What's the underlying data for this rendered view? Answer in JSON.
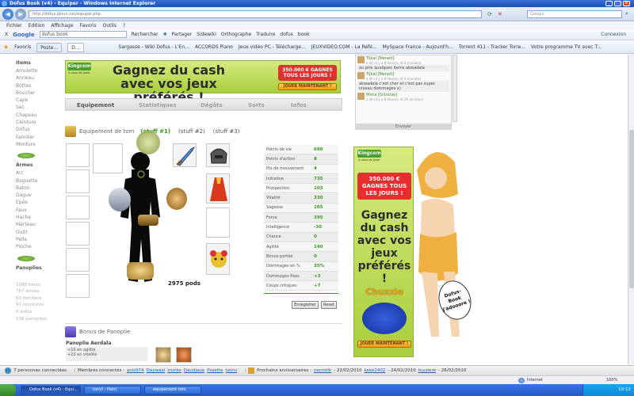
{
  "window": {
    "title": "Dofus Book (v4) - Equiper - Windows Internet Explorer"
  },
  "address": {
    "url": "http://dofus.jdoun.net/equiper.php",
    "search_placeholder": "Google"
  },
  "menu": [
    "Fichier",
    "Edition",
    "Affichage",
    "Favoris",
    "Outils",
    "?"
  ],
  "google_toolbar": {
    "close": "X",
    "brand": "Google",
    "query": "dofus book",
    "items": [
      "Rechercher",
      "Partager",
      "Sidewiki",
      "Orthographe",
      "Traduire",
      "dofus",
      "book"
    ],
    "right": "Connexion"
  },
  "favorites": {
    "label": "Favoris",
    "tabs": [
      "Poste...",
      "D..."
    ],
    "links": [
      "Sargasse - Wiki Dofus - L'En...",
      "ACCORDS Piano",
      "Jeux vidéo PC - Télécharge...",
      "JEUXVIDEO.COM - La Réfé...",
      "MySpace France - Aujourd'h...",
      "Torrent 411 - Tracker Torre...",
      "Votre programme TV avec T..."
    ]
  },
  "leftnav": {
    "items_heading": "Items",
    "items": [
      "Amulette",
      "Anneau",
      "Bottes",
      "Bouclier",
      "Cape",
      "Sac",
      "Chapeau",
      "Ceinture",
      "Dofus",
      "Familier",
      "Monture"
    ],
    "weapons_heading": "Armes",
    "weapons": [
      "Arc",
      "Baguette",
      "Baton",
      "Dague",
      "Epée",
      "Faux",
      "Hache",
      "Marteau",
      "Outil",
      "Pelle",
      "Pioche"
    ],
    "panoplies_heading": "Panoplies",
    "site_stats": [
      "1098 items",
      "767 armes",
      "60 familiers",
      "97 montures",
      "8 dofus",
      "138 panoplies"
    ]
  },
  "banner_top": {
    "title": "Gagnez du cash avec vos jeux préférés !",
    "badge": "350.000 € GAGNES TOUS LES JOURS !",
    "button": "JOUER MAINTENANT !",
    "logo": "Kingcom",
    "logo_tag": "A vous de jouer"
  },
  "tabs": [
    "Equipement",
    "Statistiques",
    "Dégâts",
    "Sorts",
    "Infos"
  ],
  "equipment": {
    "heading": "Equipement de tom",
    "stuff": [
      "(stuff #1)",
      "(stuff #2)",
      "(stuff #3)"
    ],
    "pods": "2975 pods"
  },
  "stats": [
    {
      "name": "Points de vie",
      "value": "680"
    },
    {
      "name": "Points d'action",
      "value": "8"
    },
    {
      "name": "Pts de mouvement",
      "value": "4"
    },
    {
      "name": "Initiative",
      "value": "735"
    },
    {
      "name": "Prospection",
      "value": "103"
    },
    {
      "name": "Vitalité",
      "value": "330"
    },
    {
      "name": "Sagesse",
      "value": "105"
    },
    {
      "name": "Force",
      "value": "395"
    },
    {
      "name": "Intelligence",
      "value": "-30"
    },
    {
      "name": "Chance",
      "value": "0"
    },
    {
      "name": "Agilité",
      "value": "140"
    },
    {
      "name": "Bonus portée",
      "value": "0"
    },
    {
      "name": "Dommages en %",
      "value": "35%"
    },
    {
      "name": "Dommages fixes",
      "value": "+3"
    },
    {
      "name": "Coups critiques",
      "value": "+7"
    }
  ],
  "buttons": {
    "save": "Enregistrer",
    "reset": "Reset"
  },
  "panoplie": {
    "heading": "Bonus de Panoplie",
    "name": "Panoplie Aerdala",
    "bonuses": [
      "+10 en agilité",
      "+10 en vitalité"
    ]
  },
  "chat": {
    "messages": [
      {
        "name": "Tijkal [Menelt]",
        "meta": "a dit (il y a 8 heures, et 4 minutes)",
        "text": "ou prie quelques items akwadala"
      },
      {
        "name": "Tijkal [Menelt]",
        "meta": "a dit (il y a 8 heures, et 4 minutes)",
        "text": "akwadala c'est cher et c'est pas super niveau dommages x)"
      },
      {
        "name": "Mirca [Silvosse]",
        "meta": "a dit (il y a 8 heures, et 16 minutes)",
        "text": ""
      }
    ],
    "send": "Envoyer"
  },
  "banner_side": {
    "logo": "Kingcom",
    "logo_tag": "A vous de jouer",
    "badge": "350.000 € GAGNES TOUS LES JOURS !",
    "title": "Gagnez du cash avec vos jeux préférés !",
    "brand": "Chuzzle",
    "button": "JOUER MAINTENANT !"
  },
  "mascot": {
    "bubble": "Dofus-Book j'adooore !"
  },
  "statusbar": {
    "connected": "7 personnes connectées",
    "members_label": "Membres connectés :",
    "members": [
      "anis974",
      "Daywaal",
      "trunks",
      "Daudjaue",
      "Posette",
      "tatnu"
    ],
    "birthdays_label": "Prochains anniversaires :",
    "birthdays": [
      {
        "name": "necrotik",
        "date": "- 22/02/2010"
      },
      {
        "name": "keke2402",
        "date": "- 24/02/2010"
      },
      {
        "name": "tuyziere",
        "date": "- 26/02/2010"
      }
    ]
  },
  "iestatus": {
    "zone": "Internet",
    "zoom": "100%"
  },
  "taskbar": {
    "tasks": [
      "Dofus Book (v4) - Equi...",
      "tom2 - Paint",
      "equipement tom"
    ],
    "time": "10:12"
  },
  "colors": {
    "kingcom_green": "#a8cf3d",
    "stat_value": "#3a9a1a",
    "xp_blue": "#2357c8"
  }
}
